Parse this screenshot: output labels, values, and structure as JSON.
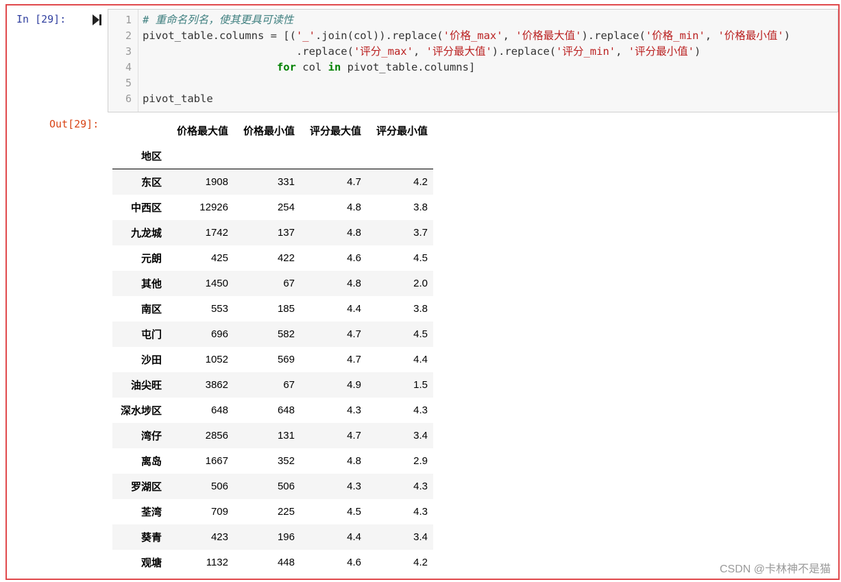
{
  "cell": {
    "in_prompt": "In  [29]:",
    "out_prompt": "Out[29]:",
    "run_icon": "run-cell-icon",
    "code": {
      "line_numbers": [
        "1",
        "2",
        "3",
        "4",
        "5",
        "6"
      ],
      "line1": "# 重命名列名，使其更具可读性",
      "line2_a": "pivot_table.columns = [(",
      "line2_s1": "'_'",
      "line2_b": ".join(col)).replace(",
      "line2_s2": "'价格_max'",
      "line2_c": ", ",
      "line2_s3": "'价格最大值'",
      "line2_d": ").replace(",
      "line2_s4": "'价格_min'",
      "line2_e": ", ",
      "line2_s5": "'价格最小值'",
      "line2_f": ")",
      "line3_a": "                        .replace(",
      "line3_s1": "'评分_max'",
      "line3_b": ", ",
      "line3_s2": "'评分最大值'",
      "line3_c": ").replace(",
      "line3_s3": "'评分_min'",
      "line3_d": ", ",
      "line3_s4": "'评分最小值'",
      "line3_e": ")",
      "line4_pad": "                     ",
      "line4_kw1": "for",
      "line4_a": " col ",
      "line4_kw2": "in",
      "line4_b": " pivot_table.columns]",
      "line6": "pivot_table"
    }
  },
  "table": {
    "columns": [
      "价格最大值",
      "价格最小值",
      "评分最大值",
      "评分最小值"
    ],
    "index_name": "地区",
    "rows": [
      {
        "index": "东区",
        "values": [
          "1908",
          "331",
          "4.7",
          "4.2"
        ]
      },
      {
        "index": "中西区",
        "values": [
          "12926",
          "254",
          "4.8",
          "3.8"
        ]
      },
      {
        "index": "九龙城",
        "values": [
          "1742",
          "137",
          "4.8",
          "3.7"
        ]
      },
      {
        "index": "元朗",
        "values": [
          "425",
          "422",
          "4.6",
          "4.5"
        ]
      },
      {
        "index": "其他",
        "values": [
          "1450",
          "67",
          "4.8",
          "2.0"
        ]
      },
      {
        "index": "南区",
        "values": [
          "553",
          "185",
          "4.4",
          "3.8"
        ]
      },
      {
        "index": "屯门",
        "values": [
          "696",
          "582",
          "4.7",
          "4.5"
        ]
      },
      {
        "index": "沙田",
        "values": [
          "1052",
          "569",
          "4.7",
          "4.4"
        ]
      },
      {
        "index": "油尖旺",
        "values": [
          "3862",
          "67",
          "4.9",
          "1.5"
        ]
      },
      {
        "index": "深水埗区",
        "values": [
          "648",
          "648",
          "4.3",
          "4.3"
        ]
      },
      {
        "index": "湾仔",
        "values": [
          "2856",
          "131",
          "4.7",
          "3.4"
        ]
      },
      {
        "index": "离岛",
        "values": [
          "1667",
          "352",
          "4.8",
          "2.9"
        ]
      },
      {
        "index": "罗湖区",
        "values": [
          "506",
          "506",
          "4.3",
          "4.3"
        ]
      },
      {
        "index": "荃湾",
        "values": [
          "709",
          "225",
          "4.5",
          "4.3"
        ]
      },
      {
        "index": "葵青",
        "values": [
          "423",
          "196",
          "4.4",
          "3.4"
        ]
      },
      {
        "index": "观塘",
        "values": [
          "1132",
          "448",
          "4.6",
          "4.2"
        ]
      }
    ]
  },
  "watermark": "CSDN @卡林神不是猫",
  "colors": {
    "frame_border": "#e0484b",
    "in_prompt": "#303f9f",
    "out_prompt": "#d84315",
    "comment": "#408080",
    "string": "#ba2121",
    "keyword": "#008000"
  }
}
